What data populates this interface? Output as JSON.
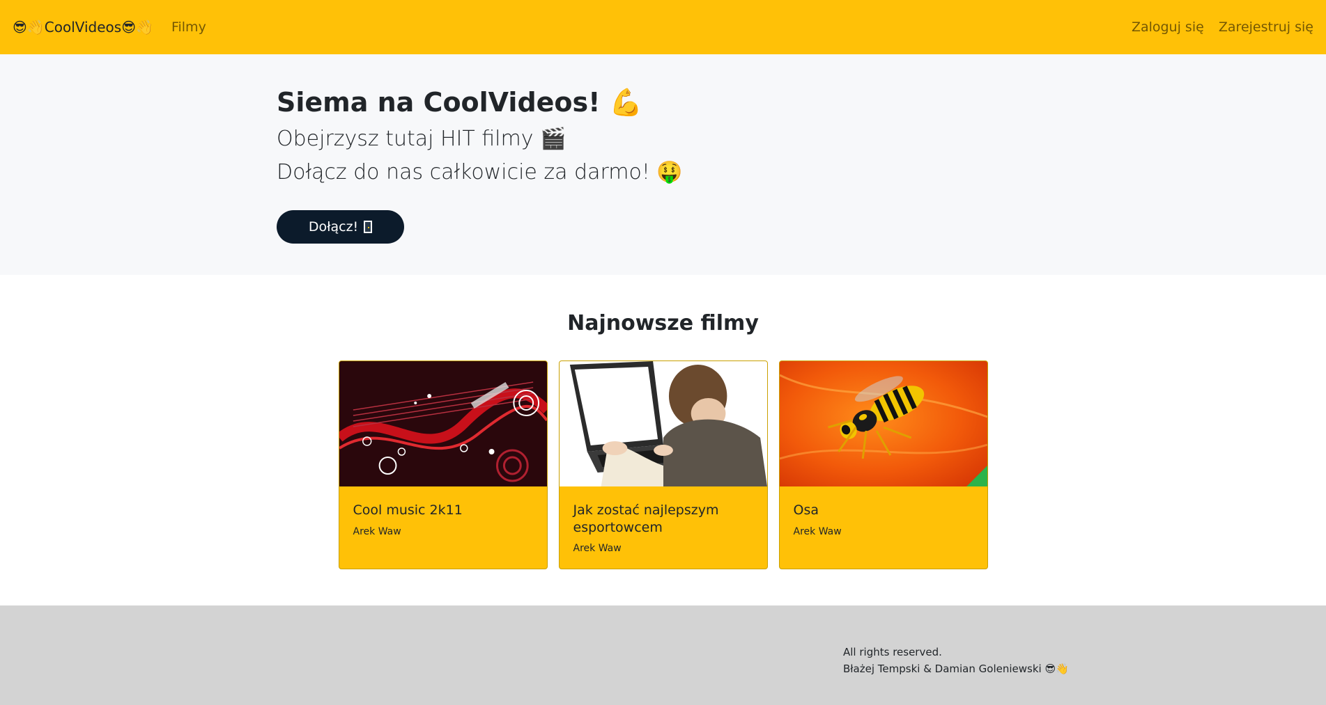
{
  "navbar": {
    "brand": "😎👋CoolVideos😎👋",
    "links": {
      "films": "Filmy",
      "login": "Zaloguj się",
      "register": "Zarejestruj się"
    }
  },
  "hero": {
    "title": "Siema na CoolVideos! 💪",
    "line1": "Obejrzysz tutaj HIT filmy 🎬",
    "line2": "Dołącz do nas całkowicie za darmo! 🤑",
    "join_label": "Dołącz!"
  },
  "latest": {
    "heading": "Najnowsze filmy",
    "videos": [
      {
        "title": "Cool music 2k11",
        "author": "Arek Waw",
        "thumb_icon": "abstract-music-thumbnail"
      },
      {
        "title": "Jak zostać najlepszym esportowcem",
        "author": "Arek Waw",
        "thumb_icon": "boy-laptop-thumbnail"
      },
      {
        "title": "Osa",
        "author": "Arek Waw",
        "thumb_icon": "wasp-thumbnail"
      }
    ]
  },
  "footer": {
    "rights": "All rights reserved.",
    "authors": "Błażej Tempski & Damian Goleniewski 😎👋"
  },
  "colors": {
    "accent": "#ffc107",
    "hero_bg": "#f7f8fa",
    "button": "#0c1b2b",
    "footer_bg": "#d3d3d3"
  }
}
